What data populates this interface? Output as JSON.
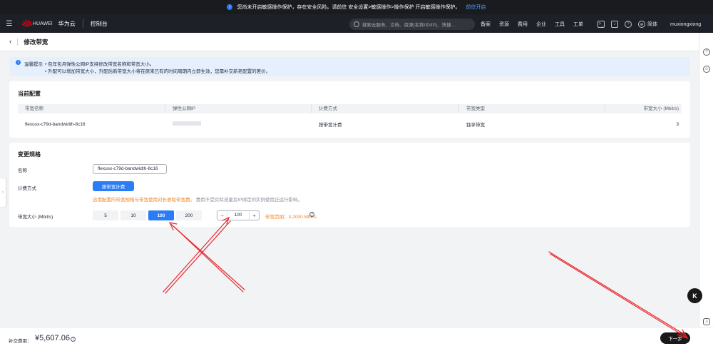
{
  "notice": {
    "text": "您尚未开启敏感操作保护，存在安全风险。请前往 安全设置>敏感操作>操作保护 开启敏感操作保护。",
    "link": "前往开启"
  },
  "topnav": {
    "logo_sub": "HUAWEI",
    "brand": "华为云",
    "console": "控制台",
    "search_placeholder": "搜索云服务、文档、资源(名称/ID/IP)、快捷...",
    "menu": [
      "备案",
      "资源",
      "费用",
      "企业",
      "工具",
      "工单"
    ],
    "language": "简体",
    "user": "muxiongxiong"
  },
  "page": {
    "title": "修改带宽"
  },
  "tip": {
    "label": "温馨提示",
    "lines": [
      "• 包年包月弹性公网IP支持修改带宽名称和带宽大小。",
      "• 升配可以增加带宽大小，升配后新带宽大小将在原来已有的时间周期内立即生效，您需补交新老配置的差价。"
    ]
  },
  "current": {
    "title": "当前配置",
    "columns": [
      "带宽名称",
      "弹性公网IP",
      "计费方式",
      "带宽类型",
      "带宽大小 (Mbit/s)"
    ],
    "row": {
      "name": "flexusx-c79d-bandwidth-8c16",
      "billing": "按带宽计费",
      "type": "独享带宽",
      "size": "3"
    }
  },
  "change": {
    "title": "变更规格",
    "name_label": "名称",
    "name_value": "flexusx-c79d-bandwidth-8c16",
    "billing_label": "计费方式",
    "billing_button": "按带宽计费",
    "hint_orange": "适用配置的带宽规格与带宽使用对长收取带宽费。",
    "hint_gray": "费用不受实际流量及IP绑定的实例使用正运行影响。",
    "bw_label": "带宽大小 (Mbit/s)",
    "options": [
      "5",
      "10",
      "100",
      "200"
    ],
    "selected_option": "100",
    "stepper_minus": "−",
    "stepper_value": "100",
    "stepper_plus": "+",
    "range": "带宽范围：3-2000 Mbit/s"
  },
  "footer": {
    "fee_label": "补交费用：",
    "fee_value": "¥5,607.06",
    "next_button": "下一步"
  },
  "icons": {
    "help": "?",
    "k_badge": "K"
  },
  "colors": {
    "primary": "#2a7cf7",
    "annotation": "#e8262b",
    "topbar": "#1e2028"
  }
}
